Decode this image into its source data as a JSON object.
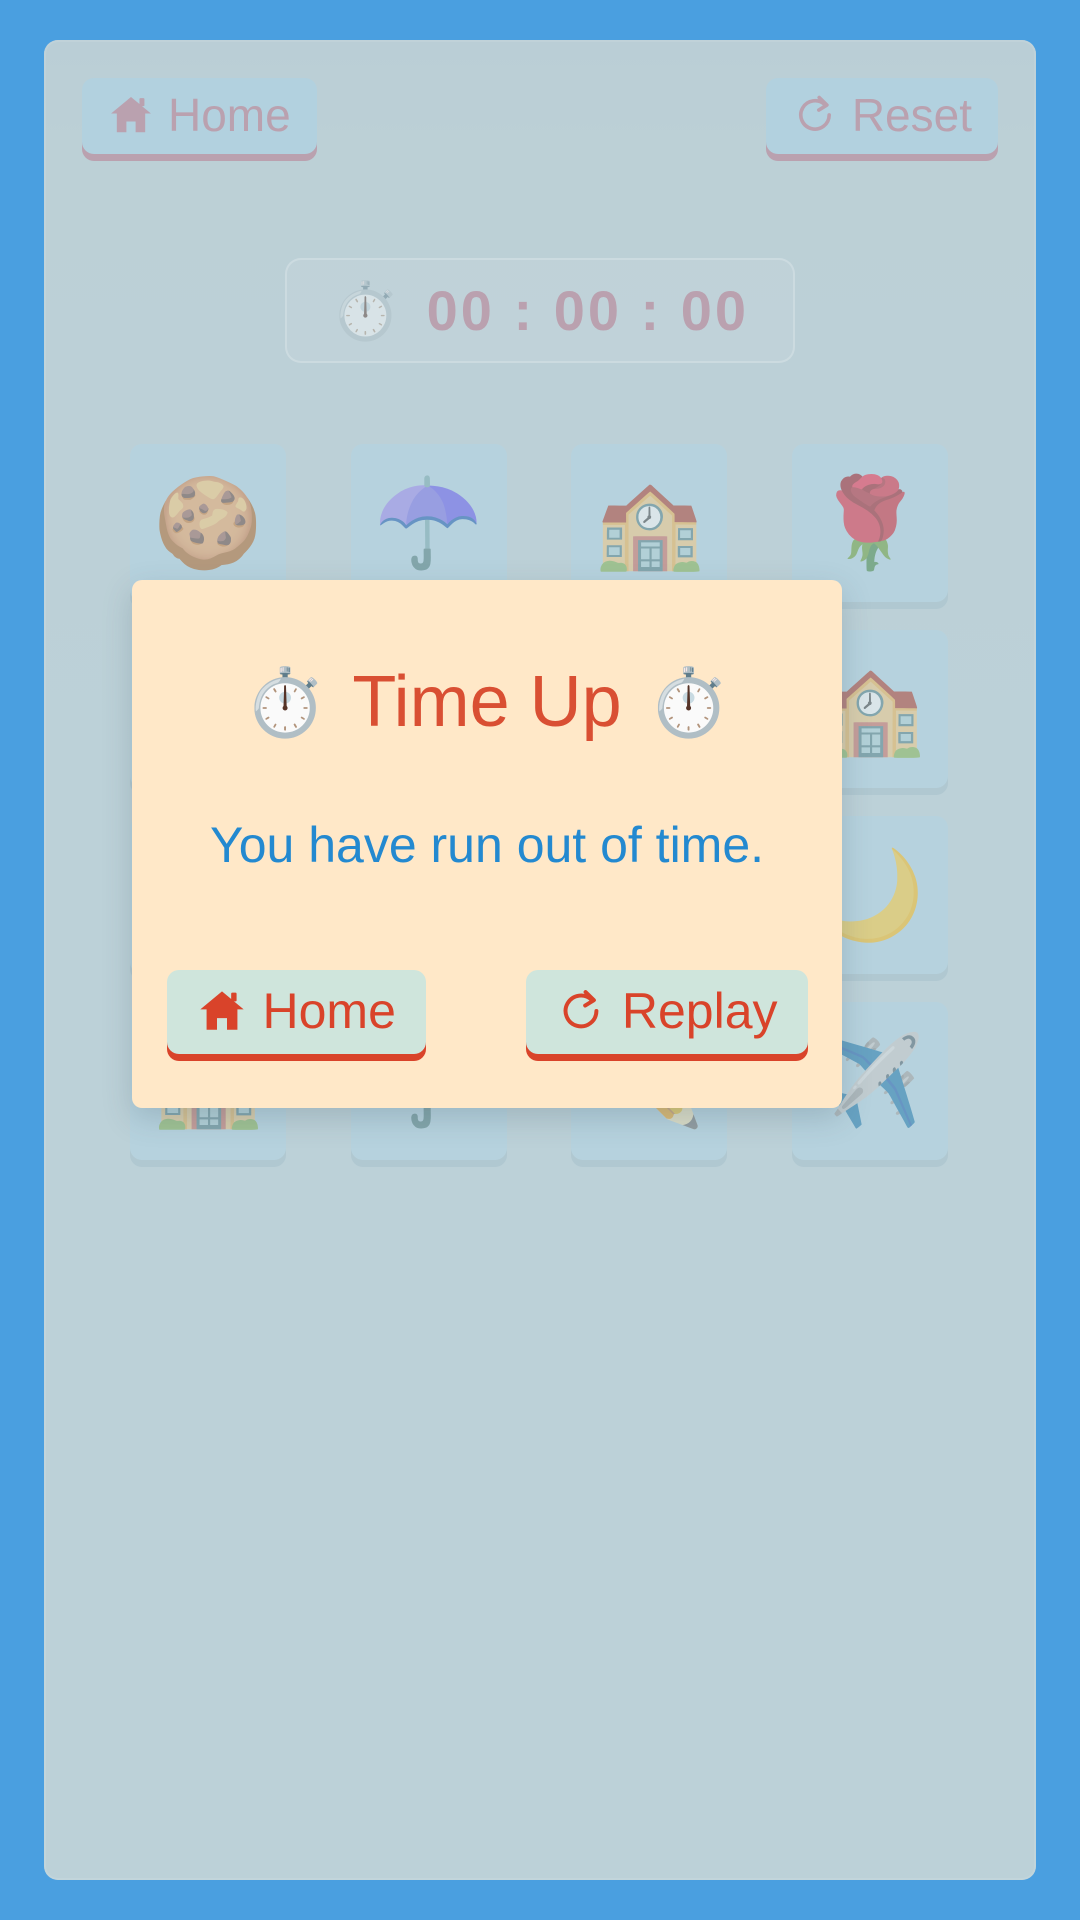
{
  "colors": {
    "page_background": "#4a9fe0",
    "board_background": "#bdd2d9",
    "top_button_bg": "#a7d3e8",
    "top_button_text": "#b9687e",
    "timer_text": "#b9687e",
    "card_face_up": "#b0d6e7",
    "card_face_down": "#bb7487",
    "modal_background": "#ffe8c8",
    "modal_title": "#d94f33",
    "modal_message": "#2389d0",
    "modal_button_bg": "#cfe5dc",
    "modal_button_text": "#d9432a"
  },
  "topbar": {
    "home_label": "Home",
    "home_icon": "home-icon",
    "reset_label": "Reset",
    "reset_icon": "redo-arrow-icon"
  },
  "timer": {
    "icon": "stopwatch-icon",
    "value": "00 : 00 : 00",
    "hours": "00",
    "minutes": "00",
    "seconds": "00"
  },
  "grid": {
    "columns": 4,
    "cards": [
      {
        "icon": "cookie-icon",
        "glyph": "🍪",
        "state": "face-up"
      },
      {
        "icon": "umbrella-icon",
        "glyph": "☂️",
        "state": "face-up"
      },
      {
        "icon": "school-icon",
        "glyph": "🏫",
        "state": "face-up"
      },
      {
        "icon": "rose-icon",
        "glyph": "🌹",
        "state": "face-up"
      },
      {
        "icon": "cookie-icon",
        "glyph": "🍪",
        "state": "face-up"
      },
      {
        "icon": "rose-icon",
        "glyph": "🌹",
        "state": "face-up"
      },
      {
        "icon": "moon-icon",
        "glyph": "🌙",
        "state": "face-up"
      },
      {
        "icon": "school-icon",
        "glyph": "🏫",
        "state": "face-up"
      },
      {
        "icon": "pencil-icon",
        "glyph": "✏️",
        "state": "face-up"
      },
      {
        "icon": "card-back",
        "glyph": "",
        "state": "face-down"
      },
      {
        "icon": "airplane-icon",
        "glyph": "✈️",
        "state": "face-up"
      },
      {
        "icon": "moon-icon",
        "glyph": "🌙",
        "state": "face-up"
      },
      {
        "icon": "school-icon",
        "glyph": "🏫",
        "state": "face-up"
      },
      {
        "icon": "umbrella-icon",
        "glyph": "☂️",
        "state": "face-up"
      },
      {
        "icon": "pencil-icon",
        "glyph": "✏️",
        "state": "face-up"
      },
      {
        "icon": "airplane-icon",
        "glyph": "✈️",
        "state": "face-up"
      }
    ]
  },
  "modal": {
    "title": "Time Up",
    "title_icon_left": "stopwatch-icon",
    "title_icon_right": "stopwatch-icon",
    "title_glyph": "⏱️",
    "message": "You have run out of time.",
    "home_label": "Home",
    "home_icon": "home-icon",
    "replay_label": "Replay",
    "replay_icon": "redo-arrow-icon"
  }
}
